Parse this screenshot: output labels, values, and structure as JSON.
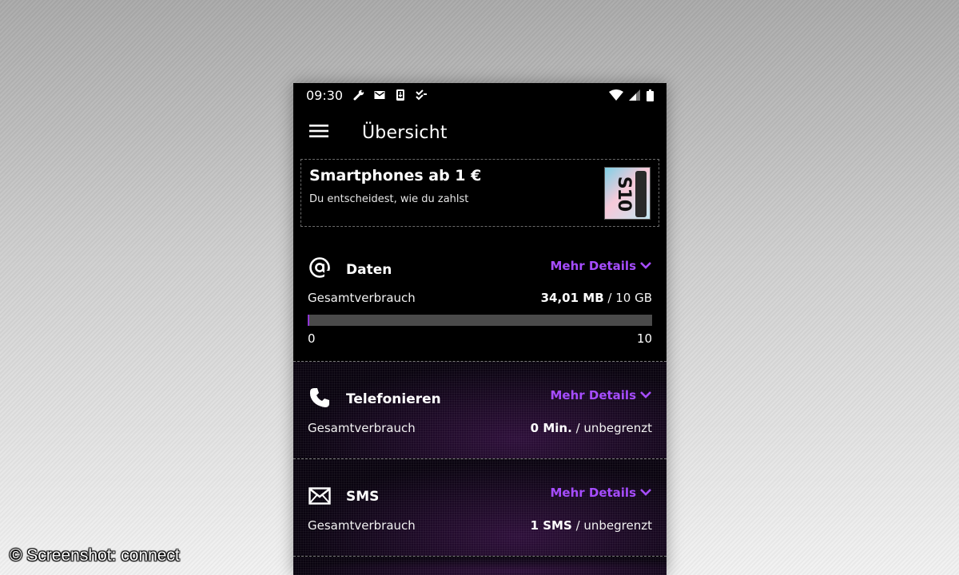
{
  "status_bar": {
    "time": "09:30",
    "left_icons": [
      "wrench-icon",
      "mail-icon",
      "download-icon",
      "checklist-icon"
    ],
    "right_icons": [
      "wifi-icon",
      "cell-signal-icon",
      "battery-icon"
    ]
  },
  "app_bar": {
    "menu_icon": "hamburger-menu-icon",
    "title": "Übersicht"
  },
  "promo": {
    "title": "Smartphones ab 1 €",
    "subtitle": "Du entscheidest, wie du zahlst",
    "image_label": "S10"
  },
  "sections": {
    "data": {
      "icon": "at-icon",
      "title": "Daten",
      "more_label": "Mehr Details",
      "usage_label": "Gesamtverbrauch",
      "used": "34,01 MB",
      "limit": "/ 10 GB",
      "progress_fraction": 0.0034,
      "scale_min": "0",
      "scale_max": "10"
    },
    "calls": {
      "icon": "phone-icon",
      "title": "Telefonieren",
      "more_label": "Mehr Details",
      "usage_label": "Gesamtverbrauch",
      "used": "0 Min.",
      "limit": "/ unbegrenzt"
    },
    "sms": {
      "icon": "envelope-icon",
      "title": "SMS",
      "more_label": "Mehr Details",
      "usage_label": "Gesamtverbrauch",
      "used": "1 SMS",
      "limit": "/ unbegrenzt"
    }
  },
  "colors": {
    "accent": "#a64dff",
    "progress_fill": "#8f35d6",
    "progress_track": "#4a4a4a"
  },
  "watermark": "© Screenshot: connect"
}
